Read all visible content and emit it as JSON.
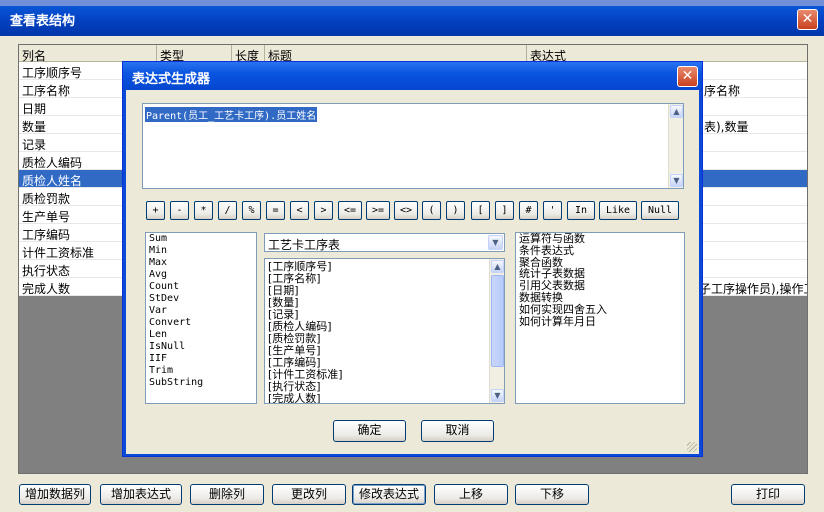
{
  "outer_window": {
    "title": "查看表结构",
    "close_glyph": "✕",
    "columns": [
      "列名",
      "类型",
      "长度",
      "标题",
      "表达式"
    ],
    "rows": [
      {
        "name": "工序顺序号",
        "expr": ""
      },
      {
        "name": "工序名称",
        "expr": "序名称"
      },
      {
        "name": "日期",
        "expr": ""
      },
      {
        "name": "数量",
        "expr": "表),数量"
      },
      {
        "name": "记录",
        "expr": ""
      },
      {
        "name": "质检人编码",
        "expr": ""
      },
      {
        "name": "质检人姓名",
        "expr": ""
      },
      {
        "name": "质检罚款",
        "expr": ""
      },
      {
        "name": "生产单号",
        "expr": ""
      },
      {
        "name": "工序编码",
        "expr": ""
      },
      {
        "name": "计件工资标准",
        "expr": ""
      },
      {
        "name": "执行状态",
        "expr": ""
      },
      {
        "name": "完成人数",
        "expr": "子工序操作员),操作工"
      }
    ],
    "selected_row_index": 6,
    "buttons": [
      "增加数据列",
      "增加表达式",
      "删除列",
      "更改列",
      "修改表达式",
      "上移",
      "下移",
      "打印"
    ]
  },
  "dialog": {
    "title": "表达式生成器",
    "close_glyph": "✕",
    "expression": "Parent(员工_工艺卡工序).员工姓名",
    "operators": [
      "+",
      "-",
      "*",
      "/",
      "%",
      "=",
      "<",
      ">",
      "<=",
      ">=",
      "<>",
      "(",
      ")",
      "[",
      "]",
      "#",
      "'",
      "In",
      "Like",
      "Null"
    ],
    "functions": [
      "Sum",
      "Min",
      "Max",
      "Avg",
      "Count",
      "StDev",
      "Var",
      "Convert",
      "Len",
      "IsNull",
      "IIF",
      "Trim",
      "SubString"
    ],
    "table_select": "工艺卡工序表",
    "fields": [
      "[工序顺序号]",
      "[工序名称]",
      "[日期]",
      "[数量]",
      "[记录]",
      "[质检人编码]",
      "[质检罚款]",
      "[生产单号]",
      "[工序编码]",
      "[计件工资标准]",
      "[执行状态]",
      "[完成人数]"
    ],
    "help_topics": [
      "运算符与函数",
      "条件表达式",
      "聚合函数",
      "统计子表数据",
      "引用父表数据",
      "数据转换",
      "如何实现四舍五入",
      "如何计算年月日"
    ],
    "ok_label": "确定",
    "cancel_label": "取消"
  },
  "icons": {
    "up_arrow": "▲",
    "down_arrow": "▼"
  }
}
